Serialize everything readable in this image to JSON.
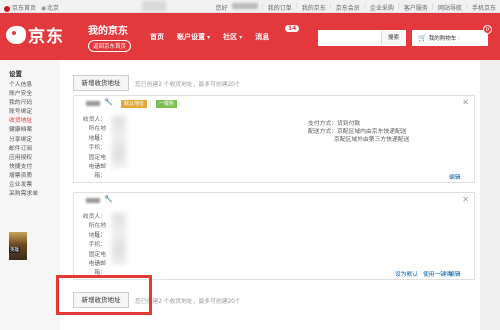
{
  "topbar": {
    "home_label": "京东首页",
    "location": "北京",
    "welcome_prefix": "您好",
    "links": [
      "我的订单",
      "我的京东",
      "京东会员",
      "企业采购",
      "客户服务",
      "网站导航",
      "手机京东"
    ]
  },
  "header": {
    "brand": "京东",
    "my_jd_title": "我的京东",
    "back_home_label": "返回京东首页",
    "nav": [
      "首页",
      "账户设置",
      "社区",
      "消息"
    ],
    "message_count": "14",
    "search_button": "搜索",
    "cart_label": "我的购物车",
    "cart_count": "0"
  },
  "sidebar": {
    "heading": "设置",
    "items": [
      "个人信息",
      "账户安全",
      "我的尺码",
      "账号绑定",
      "收货地址",
      "健康档案",
      "分享绑定",
      "邮件订阅",
      "应用授权",
      "快捷支付",
      "增票资质",
      "企业发票",
      "采购需求单"
    ],
    "active_index": 4,
    "game_caption": "英雄"
  },
  "main": {
    "add_button_label": "新增收货地址",
    "hint_text": "您已创建2 个收货地址，最多可创建20个",
    "cards": [
      {
        "default_tag": "默认地址",
        "oneclick_tag": "一键购",
        "field_labels": [
          "收货人：",
          "所在地区：",
          "地址：",
          "手机：",
          "固定电话：",
          "电子邮箱："
        ],
        "right_info": [
          "支付方式：货到付款",
          "配送方式：京配区域内由京东快递配送",
          "京配区域外由第三方快递配送"
        ],
        "links": [
          "编辑"
        ]
      },
      {
        "field_labels": [
          "收货人：",
          "所在地区：",
          "地址：",
          "手机：",
          "固定电话：",
          "电子邮箱："
        ],
        "links": [
          "设为默认",
          "使用一键购",
          "编辑"
        ]
      }
    ]
  },
  "colors": {
    "brand_red": "#e3393c",
    "link_blue": "#005ea7",
    "highlight_red": "#e53935"
  }
}
